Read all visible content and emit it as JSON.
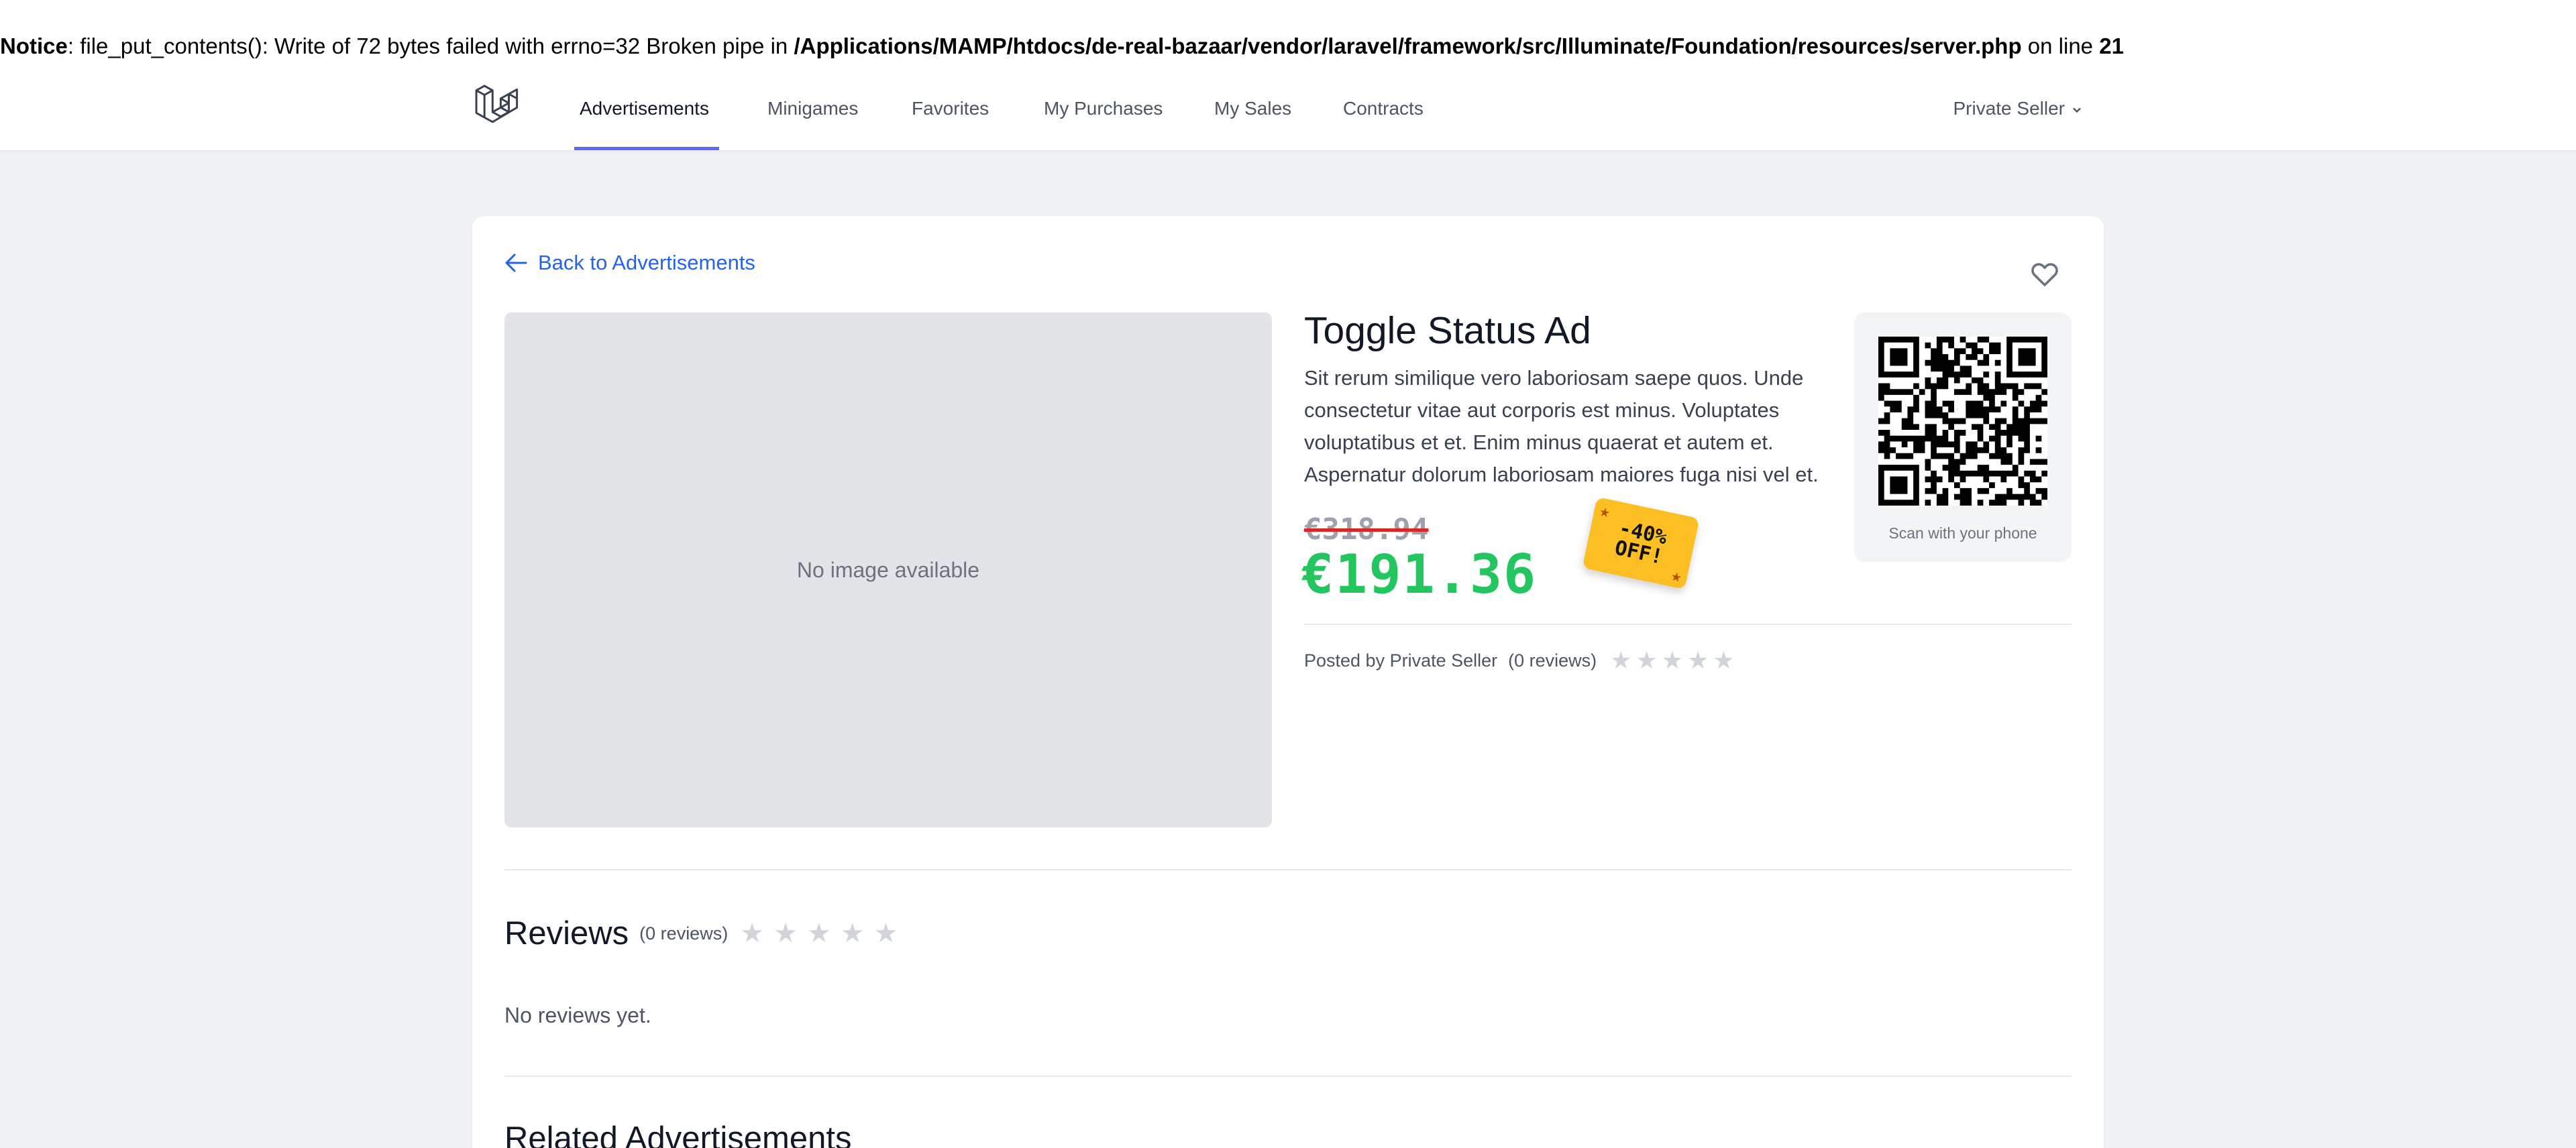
{
  "notice": {
    "label": "Notice",
    "message": ": file_put_contents(): Write of 72 bytes failed with errno=32 Broken pipe in ",
    "path": "/Applications/MAMP/htdocs/de-real-bazaar/vendor/laravel/framework/src/Illuminate/Foundation/resources/server.php",
    "line_text": " on line ",
    "line_number": "21"
  },
  "nav": {
    "logo_icon": "laravel-logo-icon",
    "links": [
      "Advertisements",
      "Minigames",
      "Favorites",
      "My Purchases",
      "My Sales",
      "Contracts"
    ],
    "active": "Advertisements",
    "user": "Private Seller",
    "accent_color": "#6366f1"
  },
  "ad": {
    "back_label": "Back to Advertisements",
    "favorite_icon": "heart-icon",
    "image_placeholder": "No image available",
    "title": "Toggle Status Ad",
    "description": "Sit rerum similique vero laboriosam saepe quos. Unde consectetur vitae aut corporis est minus. Voluptates voluptatibus et et. Enim minus quaerat et autem et. Aspernatur dolorum laboriosam maiores fuga nisi vel et.",
    "old_price": "€318.94",
    "new_price": "€191.36",
    "discount_line1": "-40%",
    "discount_line2": "OFF!",
    "qr_caption": "Scan with your phone",
    "posted_by": "Posted by Private Seller",
    "review_count": "(0 reviews)",
    "rating": 0,
    "rating_max": 5,
    "price_color": "#22c55e",
    "badge_color": "#fbbf24"
  },
  "reviews": {
    "title": "Reviews",
    "count": "(0 reviews)",
    "rating": 0,
    "empty": "No reviews yet."
  },
  "related": {
    "title": "Related Advertisements"
  }
}
